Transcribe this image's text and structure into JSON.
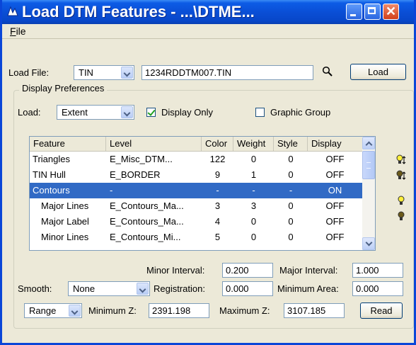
{
  "window": {
    "title": "Load DTM Features - ...\\DTME..."
  },
  "menu": {
    "file": "File"
  },
  "load_file": {
    "label": "Load File:",
    "type_value": "TIN",
    "path": "1234RDDTM007.TIN",
    "load_button": "Load"
  },
  "display_prefs": {
    "title": "Display Preferences",
    "load_label": "Load:",
    "load_value": "Extent",
    "display_only_label": "Display Only",
    "display_only_checked": true,
    "graphic_group_label": "Graphic Group",
    "graphic_group_checked": false
  },
  "table": {
    "headers": [
      "Feature",
      "Level",
      "Color",
      "Weight",
      "Style",
      "Display"
    ],
    "rows": [
      {
        "feature": "Triangles",
        "level": "E_Misc_DTM...",
        "color": "122",
        "weight": "0",
        "style": "0",
        "display": "OFF",
        "selected": false,
        "indent": false
      },
      {
        "feature": "TIN Hull",
        "level": "E_BORDER",
        "color": "9",
        "weight": "1",
        "style": "0",
        "display": "OFF",
        "selected": false,
        "indent": false
      },
      {
        "feature": "Contours",
        "level": "-",
        "color": "-",
        "weight": "-",
        "style": "-",
        "display": "ON",
        "selected": true,
        "indent": false
      },
      {
        "feature": "Major Lines",
        "level": "E_Contours_Ma...",
        "color": "3",
        "weight": "3",
        "style": "0",
        "display": "OFF",
        "selected": false,
        "indent": true
      },
      {
        "feature": "Major Label",
        "level": "E_Contours_Ma...",
        "color": "4",
        "weight": "0",
        "style": "0",
        "display": "OFF",
        "selected": false,
        "indent": true
      },
      {
        "feature": "Minor Lines",
        "level": "E_Contours_Mi...",
        "color": "5",
        "weight": "0",
        "style": "0",
        "display": "OFF",
        "selected": false,
        "indent": true
      }
    ]
  },
  "settings": {
    "minor_interval_label": "Minor Interval:",
    "minor_interval": "0.200",
    "major_interval_label": "Major Interval:",
    "major_interval": "1.000",
    "smooth_label": "Smooth:",
    "smooth_value": "None",
    "registration_label": "Registration:",
    "registration": "0.000",
    "min_area_label": "Minimum Area:",
    "min_area": "0.000"
  },
  "range": {
    "mode": "Range",
    "min_z_label": "Minimum Z:",
    "min_z": "2391.198",
    "max_z_label": "Maximum Z:",
    "max_z": "3107.185",
    "read_button": "Read"
  },
  "icons": {
    "app": "app-icon",
    "search": "search-icon",
    "side": [
      "lightbulb-on-toggle-icon",
      "lightbulb-off-toggle-icon",
      "lightbulb-on-icon",
      "lightbulb-off-icon"
    ]
  },
  "colors": {
    "title_bar": "#0a4fd6",
    "selection": "#316ac5",
    "window_bg": "#ece9d8"
  }
}
